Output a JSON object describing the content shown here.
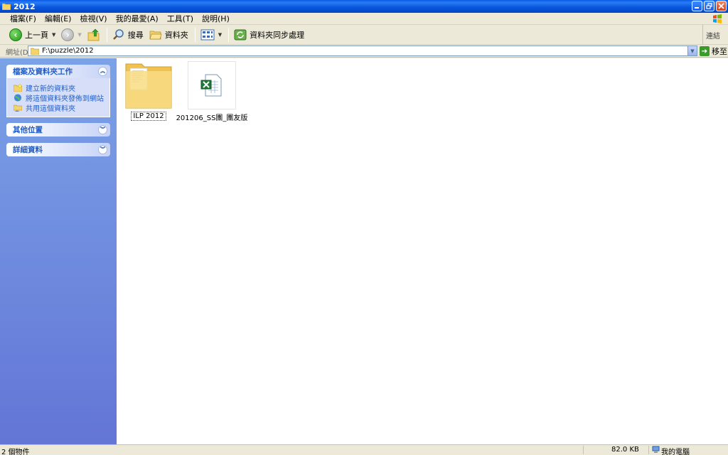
{
  "window": {
    "title": "2012"
  },
  "menu": [
    "檔案(F)",
    "編輯(E)",
    "檢視(V)",
    "我的最愛(A)",
    "工具(T)",
    "說明(H)"
  ],
  "toolbar": {
    "back_label": "上一頁",
    "search_label": "搜尋",
    "folders_label": "資料夾",
    "sync_label": "資料夾同步處理",
    "links_label": "連結"
  },
  "address": {
    "label": "網址(D)",
    "value": "F:\\puzzle\\2012",
    "go_label": "移至"
  },
  "taskpane": {
    "file_tasks": {
      "title": "檔案及資料夾工作",
      "items": [
        "建立新的資料夾",
        "將這個資料夾發佈到網站",
        "共用這個資料夾"
      ]
    },
    "other_places": {
      "title": "其他位置"
    },
    "details": {
      "title": "詳細資料"
    }
  },
  "files": [
    {
      "name": "ILP 2012",
      "type": "folder",
      "icon": "folder-icon"
    },
    {
      "name": "201206_SS團_團友版",
      "type": "excel",
      "icon": "excel-file-icon"
    }
  ],
  "status": {
    "objects": "2 個物件",
    "size": "82.0 KB",
    "location": "我的電腦"
  },
  "colors": {
    "titlebar": "#0a58dc",
    "taskpane": "#7ba2e7",
    "task_link": "#215dc6"
  }
}
